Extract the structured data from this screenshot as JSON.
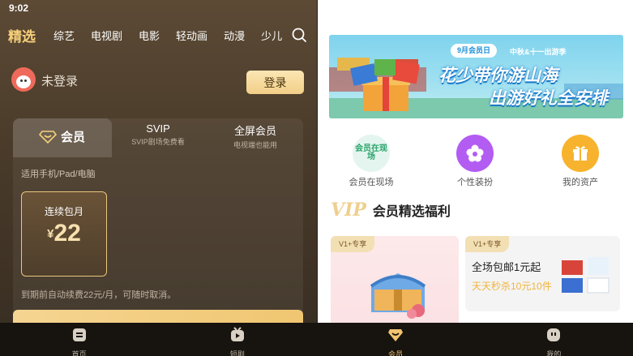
{
  "status_bar": {
    "time": "9:02"
  },
  "top_nav": {
    "tabs": [
      {
        "label": "精选",
        "active": true
      },
      {
        "label": "综艺"
      },
      {
        "label": "电视剧"
      },
      {
        "label": "电影"
      },
      {
        "label": "轻动画"
      },
      {
        "label": "动漫"
      },
      {
        "label": "少儿"
      }
    ],
    "search_icon": "search-icon"
  },
  "account": {
    "status_text": "未登录",
    "login_label": "登录"
  },
  "membership_tabs": {
    "vip": {
      "label": "会员"
    },
    "svip": {
      "label": "SVIP",
      "sub": "SVIP剧场免费看"
    },
    "fullscreen": {
      "label": "全屏会员",
      "sub": "电视端也能用"
    }
  },
  "devices_text": "适用手机/Pad/电脑",
  "plan": {
    "name": "连续包月",
    "currency": "¥",
    "price": "22"
  },
  "renew_note": "到期前自动续费22元/月，可随时取消。",
  "banner": {
    "pill_text": "9月会员日",
    "pill_right": "中秋&十一出游季",
    "headline_1": "花少带你游山海",
    "headline_2": "出游好礼全安排"
  },
  "quick_links": [
    {
      "label": "会员在现场",
      "icon_text": "会员在现场",
      "color": "#e4f5ef"
    },
    {
      "label": "个性装扮",
      "color": "#b35cf2"
    },
    {
      "label": "我的资产",
      "color": "#f7b32d"
    }
  ],
  "vip_section": {
    "mark": "VIP",
    "title": "会员精选福利"
  },
  "welfare_cards": [
    {
      "badge": "V1+专享"
    },
    {
      "badge": "V1+专享",
      "title": "全场包邮1元起",
      "sub": "天天秒杀10元10件"
    }
  ],
  "bottom_nav": [
    {
      "label": "首页",
      "icon": "home-icon"
    },
    {
      "label": "短剧",
      "icon": "short-drama-icon"
    },
    {
      "label": "会员",
      "icon": "vip-diamond-icon",
      "active": true
    },
    {
      "label": "我的",
      "icon": "profile-icon"
    }
  ],
  "colors": {
    "gold": "#f6cf7a",
    "accent_orange": "#f0b43c",
    "bg_dark": "#4a3b2a"
  }
}
